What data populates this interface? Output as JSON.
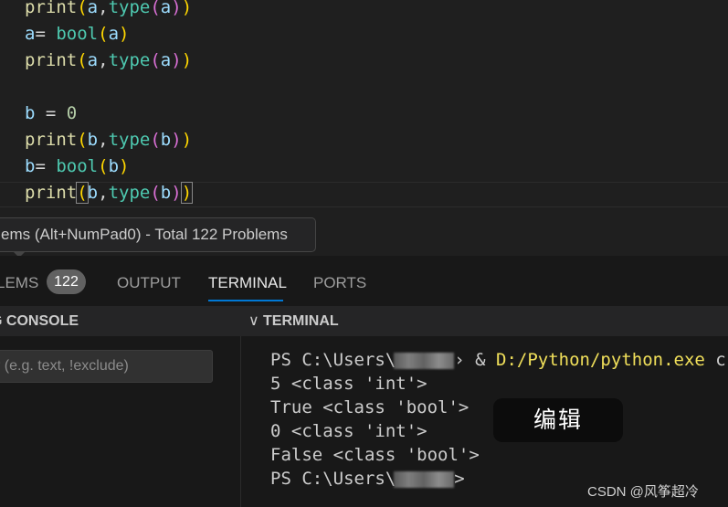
{
  "editor": {
    "code": [
      {
        "tokens": [
          {
            "t": "print",
            "c": "t-fn"
          },
          {
            "t": "(",
            "c": "t-p1"
          },
          {
            "t": "a",
            "c": "t-var"
          },
          {
            "t": ",",
            "c": "t-op"
          },
          {
            "t": "type",
            "c": "t-bi"
          },
          {
            "t": "(",
            "c": "t-p2"
          },
          {
            "t": "a",
            "c": "t-var"
          },
          {
            "t": ")",
            "c": "t-p2"
          },
          {
            "t": ")",
            "c": "t-p1"
          }
        ]
      },
      {
        "tokens": [
          {
            "t": "a",
            "c": "t-var"
          },
          {
            "t": "= ",
            "c": "t-op"
          },
          {
            "t": "bool",
            "c": "t-bi"
          },
          {
            "t": "(",
            "c": "t-p1"
          },
          {
            "t": "a",
            "c": "t-var"
          },
          {
            "t": ")",
            "c": "t-p1"
          }
        ]
      },
      {
        "tokens": [
          {
            "t": "print",
            "c": "t-fn"
          },
          {
            "t": "(",
            "c": "t-p1"
          },
          {
            "t": "a",
            "c": "t-var"
          },
          {
            "t": ",",
            "c": "t-op"
          },
          {
            "t": "type",
            "c": "t-bi"
          },
          {
            "t": "(",
            "c": "t-p2"
          },
          {
            "t": "a",
            "c": "t-var"
          },
          {
            "t": ")",
            "c": "t-p2"
          },
          {
            "t": ")",
            "c": "t-p1"
          }
        ]
      },
      {
        "tokens": []
      },
      {
        "tokens": [
          {
            "t": "b",
            "c": "t-var"
          },
          {
            "t": " = ",
            "c": "t-op"
          },
          {
            "t": "0",
            "c": "t-num"
          }
        ]
      },
      {
        "tokens": [
          {
            "t": "print",
            "c": "t-fn"
          },
          {
            "t": "(",
            "c": "t-p1"
          },
          {
            "t": "b",
            "c": "t-var"
          },
          {
            "t": ",",
            "c": "t-op"
          },
          {
            "t": "type",
            "c": "t-bi"
          },
          {
            "t": "(",
            "c": "t-p2"
          },
          {
            "t": "b",
            "c": "t-var"
          },
          {
            "t": ")",
            "c": "t-p2"
          },
          {
            "t": ")",
            "c": "t-p1"
          }
        ]
      },
      {
        "tokens": [
          {
            "t": "b",
            "c": "t-var"
          },
          {
            "t": "= ",
            "c": "t-op"
          },
          {
            "t": "bool",
            "c": "t-bi"
          },
          {
            "t": "(",
            "c": "t-p1"
          },
          {
            "t": "b",
            "c": "t-var"
          },
          {
            "t": ")",
            "c": "t-p1"
          }
        ]
      },
      {
        "tokens": [
          {
            "t": "print",
            "c": "t-fn"
          },
          {
            "t": "(",
            "c": "t-pm"
          },
          {
            "t": "b",
            "c": "t-var"
          },
          {
            "t": ",",
            "c": "t-op"
          },
          {
            "t": "type",
            "c": "t-bi"
          },
          {
            "t": "(",
            "c": "t-p2"
          },
          {
            "t": "b",
            "c": "t-var"
          },
          {
            "t": ")",
            "c": "t-p2"
          },
          {
            "t": ")",
            "c": "t-pm"
          }
        ]
      }
    ]
  },
  "tooltip": {
    "text": "ems (Alt+NumPad0) - Total 122 Problems"
  },
  "panel": {
    "tabs": {
      "problems": "LEMS",
      "problems_count": "122",
      "output": "OUTPUT",
      "terminal": "TERMINAL",
      "ports": "PORTS"
    },
    "debug_console": {
      "header": "G CONSOLE",
      "filter_placeholder": "r (e.g. text, !exclude)"
    },
    "terminal": {
      "header": "TERMINAL",
      "lines": {
        "l1_prompt": "PS C:\\Users\\",
        "l1_sep": "› & ",
        "l1_cmd": "D:/Python/python.exe",
        "l1_tail": " c",
        "l2": "5 <class 'int'>",
        "l3": "True <class 'bool'>",
        "l4": "0 <class 'int'>",
        "l5": "False <class 'bool'>",
        "l6_prompt": "PS C:\\Users\\",
        "l6_tail": ">"
      },
      "popup": "编辑"
    }
  },
  "watermark": "CSDN @风筝超冷",
  "colors": {
    "background": "#1f1f1f",
    "panel": "#181818",
    "accent": "#0078d4",
    "badge": "#616161"
  }
}
